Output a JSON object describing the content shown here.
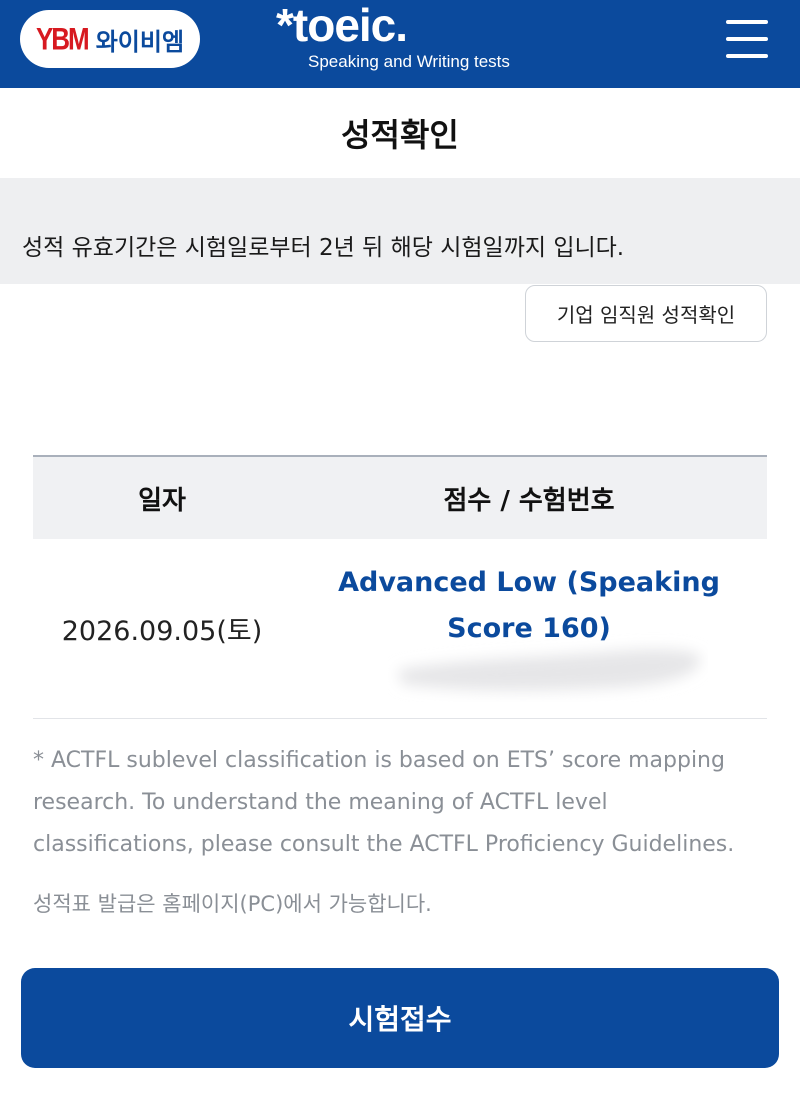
{
  "header": {
    "ybm_mark": "YBM",
    "ybm_name": "와이비엠",
    "toeic_word": "*toeic.",
    "toeic_sub": "Speaking and Writing tests",
    "menu_icon": "hamburger-menu-icon"
  },
  "page": {
    "title": "성적확인",
    "notice": "성적 유효기간은 시험일로부터 2년 뒤 해당 시험일까지 입니다.",
    "corp_button": "기업 임직원 성적확인"
  },
  "table": {
    "headers": [
      "일자",
      "점수 / 수험번호"
    ],
    "rows": [
      {
        "date": "2026.09.05(토)",
        "score": "Advanced Low (Speaking Score 160)"
      }
    ]
  },
  "footnote": "* ACTFL sublevel classification is based on ETS’ score mapping research. To understand the meaning of ACTFL level classifications, please consult the ACTFL Proficiency Guidelines.",
  "issue_note": "성적표 발급은 홈페이지(PC)에서 가능합니다.",
  "apply_button": "시험접수",
  "colors": {
    "brand_blue": "#0b4a9d",
    "ybm_red": "#d71920",
    "notice_bg": "#eeeff1"
  }
}
